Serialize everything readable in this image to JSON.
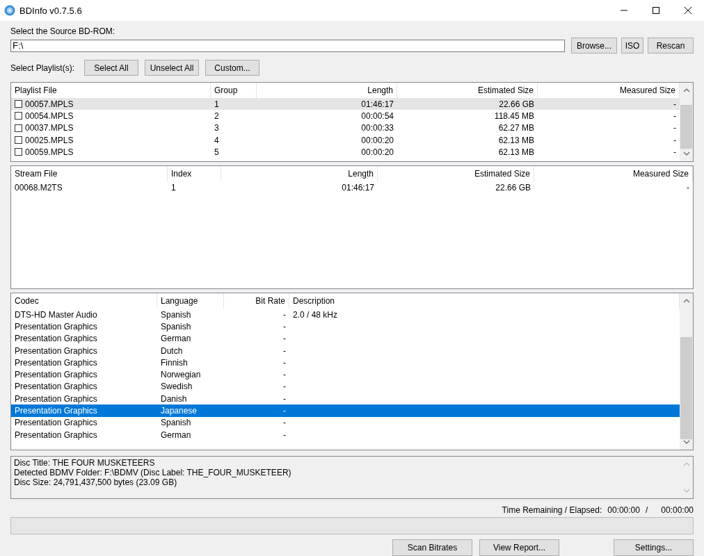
{
  "window": {
    "title": "BDInfo v0.7.5.6"
  },
  "source": {
    "label": "Select the Source BD-ROM:",
    "value": "F:\\",
    "buttons": [
      "Browse...",
      "ISO",
      "Rescan"
    ]
  },
  "playlist_select": {
    "label": "Select Playlist(s):",
    "buttons": [
      "Select All",
      "Unselect All",
      "Custom..."
    ]
  },
  "playlists": {
    "columns": [
      "Playlist File",
      "Group",
      "Length",
      "Estimated Size",
      "Measured Size"
    ],
    "rows": [
      {
        "file": "00057.MPLS",
        "group": "1",
        "length": "01:46:17",
        "estimated_size": "22.66 GB",
        "measured_size": "-",
        "checked": false,
        "highlighted": true
      },
      {
        "file": "00054.MPLS",
        "group": "2",
        "length": "00:00:54",
        "estimated_size": "118.45 MB",
        "measured_size": "-",
        "checked": false,
        "highlighted": false
      },
      {
        "file": "00037.MPLS",
        "group": "3",
        "length": "00:00:33",
        "estimated_size": "62.27 MB",
        "measured_size": "-",
        "checked": false,
        "highlighted": false
      },
      {
        "file": "00025.MPLS",
        "group": "4",
        "length": "00:00:20",
        "estimated_size": "62.13 MB",
        "measured_size": "-",
        "checked": false,
        "highlighted": false
      },
      {
        "file": "00059.MPLS",
        "group": "5",
        "length": "00:00:20",
        "estimated_size": "62.13 MB",
        "measured_size": "-",
        "checked": false,
        "highlighted": false
      }
    ]
  },
  "streams": {
    "columns": [
      "Stream File",
      "Index",
      "Length",
      "Estimated Size",
      "Measured Size"
    ],
    "rows": [
      {
        "file": "00068.M2TS",
        "index": "1",
        "length": "01:46:17",
        "estimated_size": "22.66 GB",
        "measured_size": "-"
      }
    ]
  },
  "codecs": {
    "columns": [
      "Codec",
      "Language",
      "Bit Rate",
      "Description"
    ],
    "rows": [
      {
        "codec": "DTS-HD Master Audio",
        "language": "Spanish",
        "bit_rate": "-",
        "description": "2.0 / 48 kHz",
        "selected": false
      },
      {
        "codec": "Presentation Graphics",
        "language": "Spanish",
        "bit_rate": "-",
        "selected": false
      },
      {
        "codec": "Presentation Graphics",
        "language": "German",
        "bit_rate": "-",
        "selected": false
      },
      {
        "codec": "Presentation Graphics",
        "language": "Dutch",
        "bit_rate": "-",
        "selected": false
      },
      {
        "codec": "Presentation Graphics",
        "language": "Finnish",
        "bit_rate": "-",
        "selected": false
      },
      {
        "codec": "Presentation Graphics",
        "language": "Norwegian",
        "bit_rate": "-",
        "selected": false
      },
      {
        "codec": "Presentation Graphics",
        "language": "Swedish",
        "bit_rate": "-",
        "selected": false
      },
      {
        "codec": "Presentation Graphics",
        "language": "Danish",
        "bit_rate": "-",
        "selected": false
      },
      {
        "codec": "Presentation Graphics",
        "language": "Japanese",
        "bit_rate": "-",
        "selected": true
      },
      {
        "codec": "Presentation Graphics",
        "language": "Spanish",
        "bit_rate": "-",
        "selected": false
      },
      {
        "codec": "Presentation Graphics",
        "language": "German",
        "bit_rate": "-",
        "selected": false
      }
    ]
  },
  "info": [
    "Disc Title: THE FOUR MUSKETEERS",
    "Detected BDMV Folder: F:\\BDMV (Disc Label: THE_FOUR_MUSKETEER)",
    "Disc Size: 24,791,437,500 bytes (23.09 GB)"
  ],
  "progress": {
    "label": "Time Remaining / Elapsed:",
    "remaining": "00:00:00",
    "separator": "/",
    "elapsed": "00:00:00",
    "level": 0
  },
  "footer_buttons": [
    "Scan Bitrates",
    "View Report...",
    "Settings..."
  ]
}
